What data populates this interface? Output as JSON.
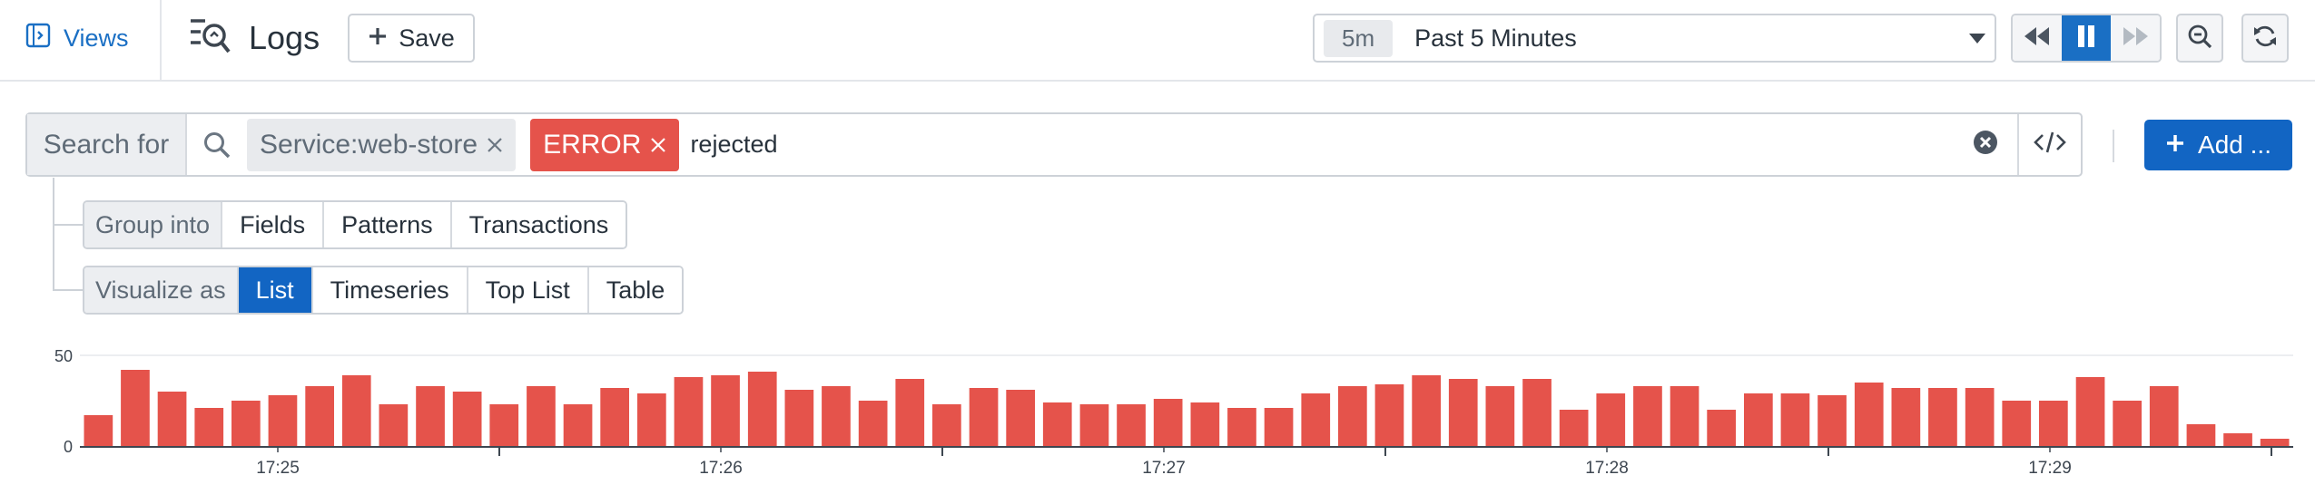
{
  "header": {
    "views_label": "Views",
    "title": "Logs",
    "save_label": "Save",
    "time_badge": "5m",
    "time_label": "Past 5 Minutes"
  },
  "search": {
    "search_for_label": "Search for",
    "tags": [
      {
        "label": "Service:web-store"
      },
      {
        "label": "ERROR"
      }
    ],
    "query": "rejected",
    "add_label": "Add ..."
  },
  "group_into": {
    "label": "Group into",
    "options": [
      "Fields",
      "Patterns",
      "Transactions"
    ]
  },
  "visualize_as": {
    "label": "Visualize as",
    "options": [
      "List",
      "Timeseries",
      "Top List",
      "Table"
    ],
    "selected": "List"
  },
  "colors": {
    "accent": "#1265c3",
    "error": "#e5534b"
  },
  "chart_data": {
    "type": "bar",
    "ylim": [
      0,
      50
    ],
    "yticks": [
      "0",
      "50"
    ],
    "xticks": [
      "17:25",
      "17:26",
      "17:27",
      "17:28",
      "17:29"
    ],
    "color": "#e5534b",
    "grid": true,
    "values": [
      17,
      42,
      30,
      21,
      25,
      28,
      33,
      39,
      23,
      33,
      30,
      23,
      33,
      23,
      32,
      29,
      38,
      39,
      41,
      31,
      33,
      25,
      37,
      23,
      32,
      31,
      24,
      23,
      23,
      26,
      24,
      21,
      21,
      29,
      33,
      34,
      39,
      37,
      33,
      37,
      20,
      29,
      33,
      33,
      20,
      29,
      29,
      28,
      35,
      32,
      32,
      32,
      25,
      25,
      38,
      25,
      33,
      12,
      7,
      4
    ]
  }
}
